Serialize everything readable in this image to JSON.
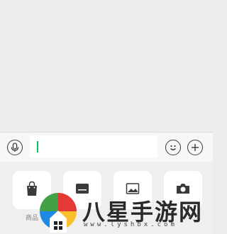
{
  "input_bar": {
    "text_value": "",
    "icons": [
      "microphone-icon",
      "emoji-icon",
      "plus-icon"
    ]
  },
  "tools": [
    {
      "icon": "shopping-bag-icon",
      "label": "商品"
    },
    {
      "icon": "card-icon",
      "label": ""
    },
    {
      "icon": "image-icon",
      "label": ""
    },
    {
      "icon": "camera-icon",
      "label": ""
    }
  ],
  "watermark": {
    "title": "八星手游网",
    "url": "www.lyshbx.com",
    "logo": "site-logo"
  },
  "colors": {
    "background": "#ededed",
    "input_bar": "#f7f7f7",
    "caret": "#07c160"
  }
}
